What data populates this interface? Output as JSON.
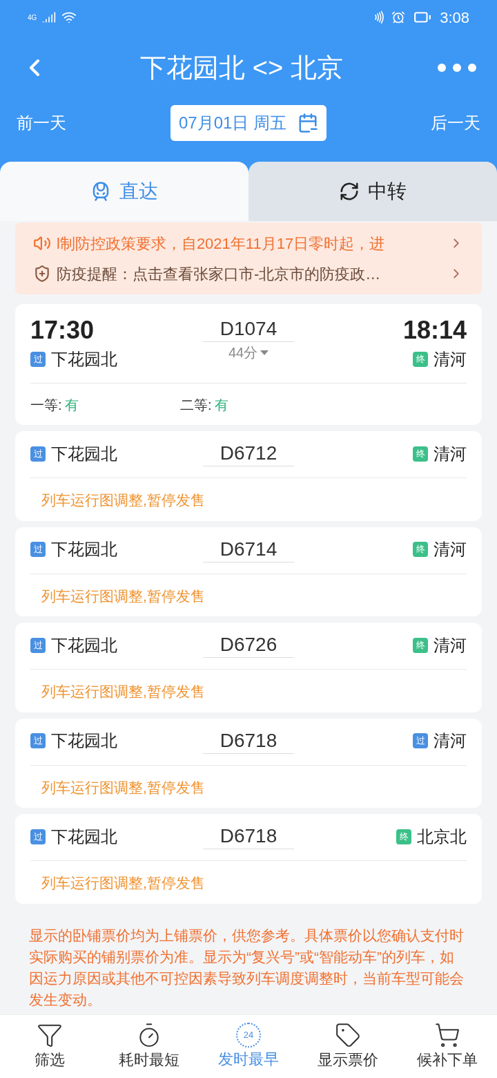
{
  "status_bar": {
    "network": "4G",
    "time": "3:08"
  },
  "header": {
    "title": "下花园北 <> 北京",
    "prev_day": "前一天",
    "next_day": "后一天",
    "date": "07月01日 周五"
  },
  "tabs": [
    {
      "label": "直达",
      "selected": true
    },
    {
      "label": "中转",
      "selected": false
    }
  ],
  "notices": [
    {
      "kind": "speaker",
      "text": "l制防控政策要求，自2021年11月17日零时起，进"
    },
    {
      "kind": "shield",
      "text": "防疫提醒：点击查看张家口市-北京市的防疫政…"
    }
  ],
  "trains": [
    {
      "kind": "full",
      "depart_time": "17:30",
      "arrive_time": "18:14",
      "number": "D1074",
      "duration": "44分",
      "from": {
        "tag": "过",
        "color": "#4a90e2",
        "name": "下花园北"
      },
      "to": {
        "tag": "终",
        "color": "#3cc08a",
        "name": "清河"
      },
      "seats": [
        {
          "label": "一等:",
          "value": "有"
        },
        {
          "label": "二等:",
          "value": "有"
        }
      ]
    },
    {
      "kind": "suspended",
      "number": "D6712",
      "from": {
        "tag": "过",
        "color": "#4a90e2",
        "name": "下花园北"
      },
      "to": {
        "tag": "终",
        "color": "#3cc08a",
        "name": "清河"
      },
      "message": "列车运行图调整,暂停发售"
    },
    {
      "kind": "suspended",
      "number": "D6714",
      "from": {
        "tag": "过",
        "color": "#4a90e2",
        "name": "下花园北"
      },
      "to": {
        "tag": "终",
        "color": "#3cc08a",
        "name": "清河"
      },
      "message": "列车运行图调整,暂停发售"
    },
    {
      "kind": "suspended",
      "number": "D6726",
      "from": {
        "tag": "过",
        "color": "#4a90e2",
        "name": "下花园北"
      },
      "to": {
        "tag": "终",
        "color": "#3cc08a",
        "name": "清河"
      },
      "message": "列车运行图调整,暂停发售"
    },
    {
      "kind": "suspended",
      "number": "D6718",
      "from": {
        "tag": "过",
        "color": "#4a90e2",
        "name": "下花园北"
      },
      "to": {
        "tag": "过",
        "color": "#4a90e2",
        "name": "清河"
      },
      "message": "列车运行图调整,暂停发售"
    },
    {
      "kind": "suspended",
      "number": "D6718",
      "from": {
        "tag": "过",
        "color": "#4a90e2",
        "name": "下花园北"
      },
      "to": {
        "tag": "终",
        "color": "#3cc08a",
        "name": "北京北"
      },
      "message": "列车运行图调整,暂停发售"
    }
  ],
  "disclaimer": "显示的卧铺票价均为上铺票价，供您参考。具体票价以您确认支付时实际购买的铺别票价为准。显示为“复兴号”或“智能动车”的列车，如因运力原因或其他不可控因素导致列车调度调整时，当前车型可能会发生变动。",
  "bottom_nav": [
    {
      "kind": "filter",
      "label": "筛选",
      "selected": false
    },
    {
      "kind": "timer",
      "label": "耗时最短",
      "selected": false
    },
    {
      "kind": "clock24",
      "label": "发时最早",
      "selected": true,
      "icon_text": "24"
    },
    {
      "kind": "tag",
      "label": "显示票价",
      "selected": false
    },
    {
      "kind": "cart",
      "label": "候补下单",
      "selected": false
    }
  ]
}
